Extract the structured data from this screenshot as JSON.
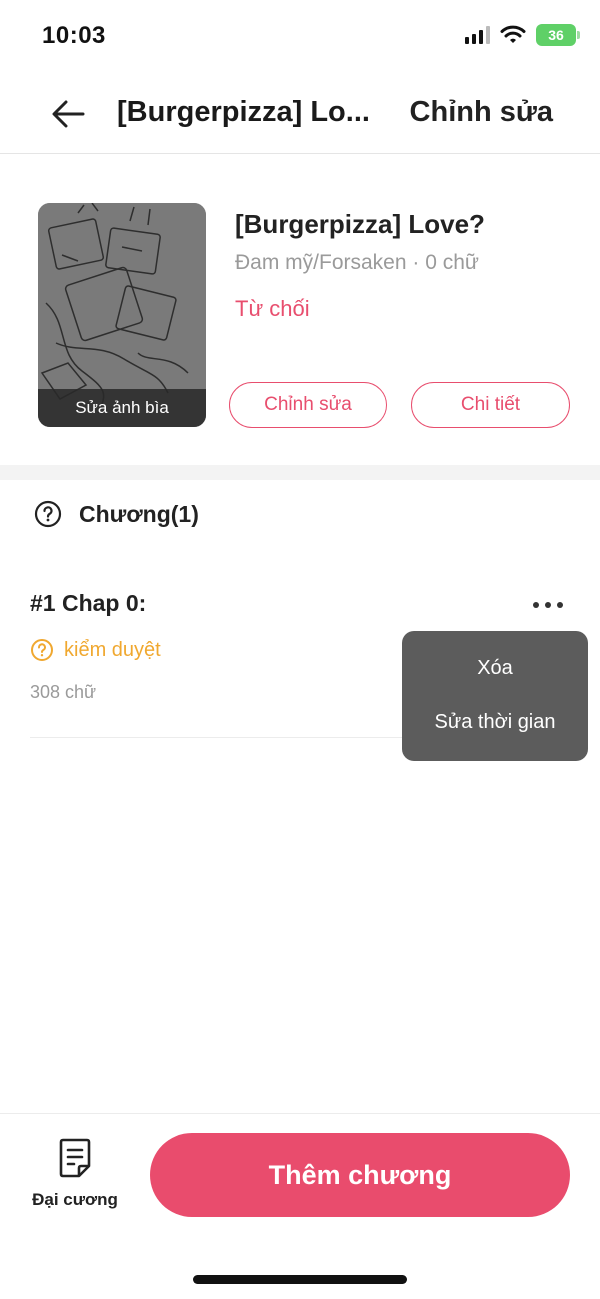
{
  "status_bar": {
    "time": "10:03",
    "battery": "36"
  },
  "nav": {
    "back_icon": "arrow-left-icon",
    "title": "[Burgerpizza] Lo...",
    "edit_label": "Chỉnh sửa"
  },
  "book": {
    "cover_label": "Sửa ảnh bìa",
    "title": "[Burgerpizza] Love?",
    "meta": "Đam mỹ/Forsaken · 0 chữ",
    "status": "Từ chối",
    "edit_button": "Chỉnh sửa",
    "detail_button": "Chi tiết"
  },
  "chapters": {
    "header": "Chương(1)",
    "items": [
      {
        "title": "#1 Chap 0:",
        "status": "kiểm duyệt",
        "words": "308 chữ"
      }
    ]
  },
  "popup_menu": {
    "items": [
      "Xóa",
      "Sửa thời gian"
    ]
  },
  "bottom_bar": {
    "outline_label": "Đại cương",
    "add_chapter_label": "Thêm chương"
  },
  "colors": {
    "accent": "#e94c6d",
    "warning": "#f0a830",
    "muted": "#9a9a9a"
  }
}
